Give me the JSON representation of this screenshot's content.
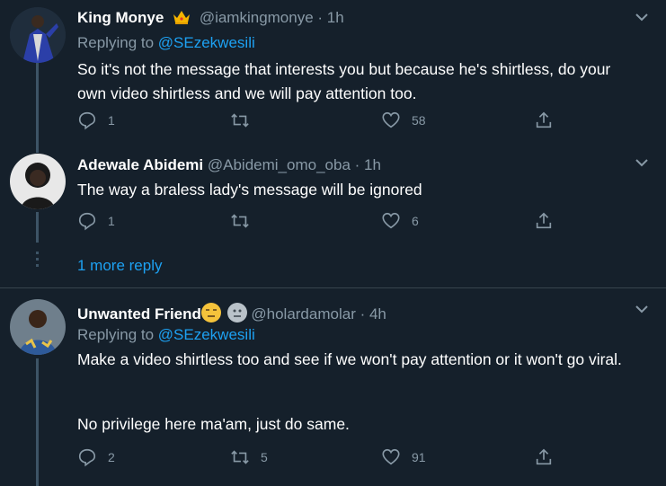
{
  "tweets": [
    {
      "name": "King Monye",
      "handle": "@iamkingmonye",
      "time": "· 1h",
      "replying_prefix": "Replying to",
      "replying_to": "@SEzekwesili",
      "text": "So it's not the message that interests you but because he's shirtless, do your own video shirtless and we will pay attention too.",
      "replies": "1",
      "retweets": "",
      "likes": "58"
    },
    {
      "name": "Adewale Abidemi",
      "handle": "@Abidemi_omo_oba",
      "time": "· 1h",
      "text": "The way a braless lady's message will be ignored",
      "replies": "1",
      "retweets": "",
      "likes": "6"
    },
    {
      "name": "Unwanted Friend",
      "handle": "@holardamolar",
      "time": "· 4h",
      "replying_prefix": "Replying to",
      "replying_to": "@SEzekwesili",
      "text": "Make a video shirtless too and see if we won't pay attention or it won't go viral.",
      "text2": "No privilege here ma'am, just do same.",
      "replies": "2",
      "retweets": "5",
      "likes": "91"
    }
  ],
  "more_replies": "1 more reply",
  "colors": {
    "background": "#15202b",
    "secondary_text": "#8899a6",
    "link": "#1da1f2",
    "thread_line": "#3d5466"
  },
  "icons": [
    "crown-icon",
    "chevron-down-icon",
    "reply-icon",
    "retweet-icon",
    "like-icon",
    "share-icon",
    "emoji-unamused-icon",
    "emoji-neutral-icon"
  ]
}
